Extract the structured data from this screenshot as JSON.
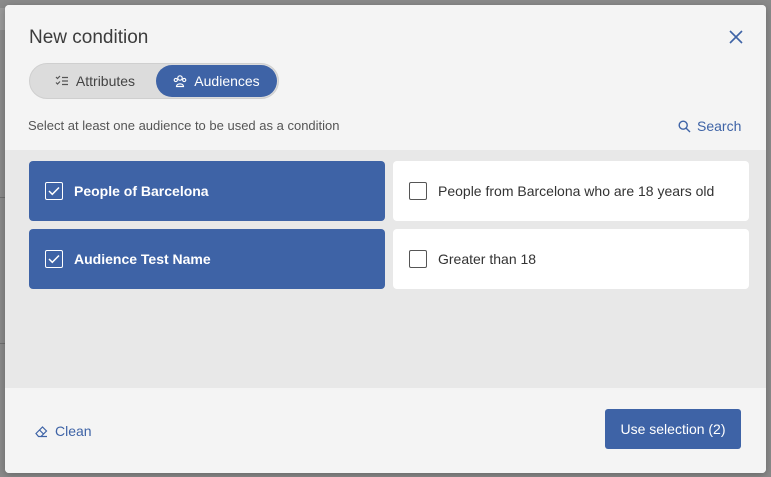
{
  "modal": {
    "title": "New condition"
  },
  "toggle": {
    "attributes_label": "Attributes",
    "audiences_label": "Audiences",
    "selected": "Audiences"
  },
  "hint": "Select at least one audience to be used as a condition",
  "search": {
    "label": "Search"
  },
  "audiences": [
    {
      "label": "People of Barcelona",
      "checked": true
    },
    {
      "label": "People from Barcelona who are 18 years old",
      "checked": false
    },
    {
      "label": "Audience Test Name",
      "checked": true
    },
    {
      "label": "Greater than 18",
      "checked": false
    }
  ],
  "footer": {
    "clean_label": "Clean",
    "use_selection_label": "Use selection (2)"
  },
  "colors": {
    "accent": "#3e63a6",
    "body_bg": "#e8e8e8"
  }
}
